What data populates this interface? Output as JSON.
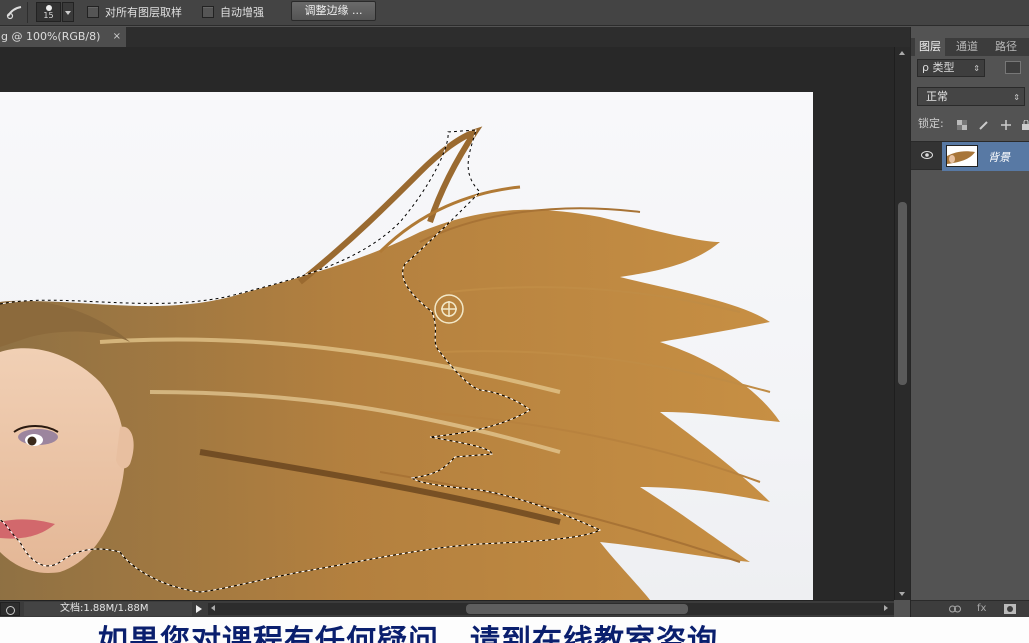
{
  "options_bar": {
    "tool_icon": "quick-selection-brush-icon",
    "brush_size": "15",
    "sample_all_layers_label": "对所有图层取样",
    "auto_enhance_label": "自动增强",
    "refine_edge_label": "调整边缘 ..."
  },
  "document_tab": {
    "title": "g @ 100%(RGB/8)",
    "close": "×"
  },
  "status_bar": {
    "doc_info": "文档:1.88M/1.88M"
  },
  "layers_panel": {
    "tabs": [
      "图层",
      "通道",
      "路径"
    ],
    "kind_filter": "ρ 类型",
    "blend_mode": "正常",
    "lock_label": "锁定:",
    "layer_name": "背景",
    "footer_icons": [
      "link-icon",
      "fx-icon",
      "mask-icon"
    ],
    "footer_fx": "fx"
  },
  "subtitle": {
    "text": "如果您对课程有任何疑问，请到在线教室咨询"
  },
  "colors": {
    "ui_dark": "#282828",
    "panel": "#535353",
    "selected_layer": "#5879a4",
    "subtitle_text": "#0a1f6e"
  }
}
